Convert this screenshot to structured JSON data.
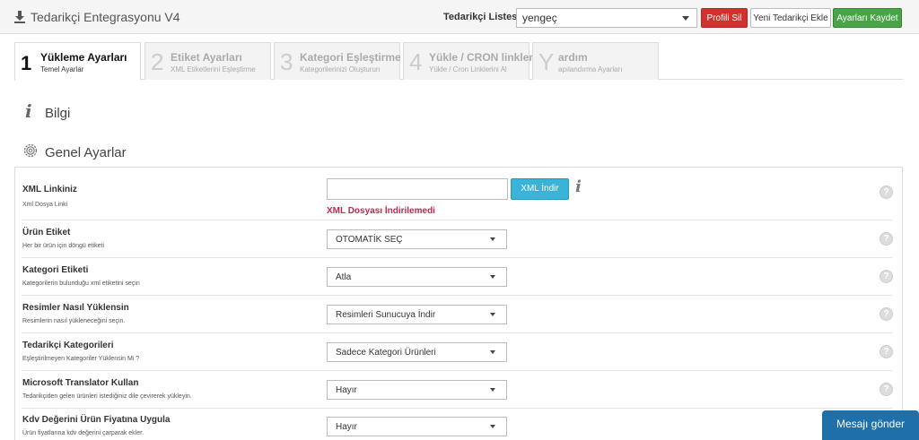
{
  "header": {
    "title": "Tedarikçi Entegrasyonu V4",
    "supplier_list_label": "Tedarikçi Listesi:",
    "supplier_selected": "yengeç",
    "delete_profile": "Profili Sil",
    "new_supplier": "Yeni Tedarikçi Ekle",
    "save_settings": "Ayarları Kaydet"
  },
  "tabs": [
    {
      "num": "1",
      "title": "Yükleme Ayarları",
      "sub": "Temel Ayarlar"
    },
    {
      "num": "2",
      "title": "Etiket Ayarları",
      "sub": "XML Etiketlerini Eşleştirme"
    },
    {
      "num": "3",
      "title": "Kategori Eşleştirme",
      "sub": "Kategorilerinizi Oluşturun"
    },
    {
      "num": "4",
      "title": "Yükle / CRON linkleri",
      "sub": "Yükle / Cron Linklerini Al"
    },
    {
      "num": "Y",
      "title": "ardım",
      "sub": "apılandırma Ayarları"
    }
  ],
  "sections": {
    "info_title": "Bilgi",
    "general_title": "Genel Ayarlar"
  },
  "xml": {
    "label": "XML Linkiniz",
    "help": "Xml Dosya Linki",
    "value": "",
    "button": "XML İndir",
    "error": "XML Dosyası İndirilemedi"
  },
  "fields": [
    {
      "label": "Ürün Etiket",
      "help": "Her bir ürün için döngü etiketi",
      "value": "OTOMATİK SEÇ"
    },
    {
      "label": "Kategori Etiketi",
      "help": "Kategorilerin bulunduğu xml etiketini seçin",
      "value": "Atla"
    },
    {
      "label": "Resimler Nasıl Yüklensin",
      "help": "Resimlerin nasıl yükleneceğini seçin.",
      "value": "Resimleri Sunucuya İndir"
    },
    {
      "label": "Tedarikçi Kategorileri",
      "help": "Eşleştirilmeyen Kategoriler Yüklensin Mi ?",
      "value": "Sadece Kategori Ürünleri"
    },
    {
      "label": "Microsoft Translator Kullan",
      "help": "Tedarikçiden gelen ürünleri istediğiniz dile çevirerek yükleyin.",
      "value": "Hayır"
    },
    {
      "label": "Kdv Değerini Ürün Fiyatına Uygula",
      "help": "Ürün fiyatlarına kdv değerini çarparak ekler.",
      "value": "Hayır"
    }
  ],
  "help_icon_text": "?",
  "chat_button": "Mesajı gönder"
}
